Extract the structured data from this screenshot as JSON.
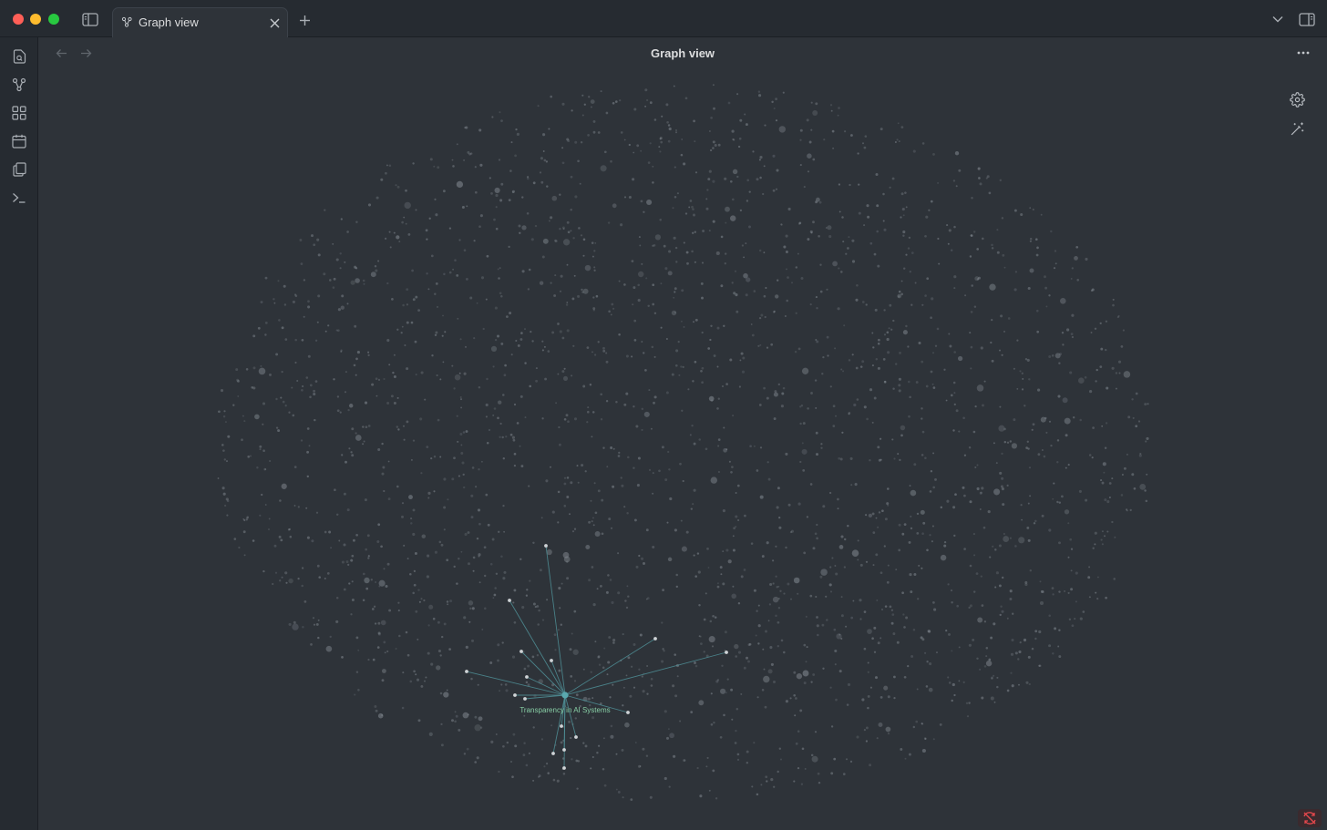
{
  "window": {
    "tab": {
      "label": "Graph view",
      "icon": "graph-icon"
    }
  },
  "toolbar": {
    "left_icons": [
      "sidebar-toggle-icon"
    ],
    "right_icons": [
      "chevron-down-icon",
      "right-sidebar-toggle-icon"
    ],
    "new_tab_icon": "plus-icon"
  },
  "ribbon": {
    "items": [
      {
        "name": "open-quick-switcher",
        "icon": "file-search-icon"
      },
      {
        "name": "open-graph-view",
        "icon": "graph-icon"
      },
      {
        "name": "open-canvas",
        "icon": "dashboard-icon"
      },
      {
        "name": "open-daily-note",
        "icon": "calendar-icon"
      },
      {
        "name": "insert-template",
        "icon": "files-icon"
      },
      {
        "name": "open-command-palette",
        "icon": "terminal-icon"
      }
    ]
  },
  "view_header": {
    "title": "Graph view",
    "back_icon": "arrow-left-icon",
    "forward_icon": "arrow-right-icon",
    "more_icon": "more-options-icon"
  },
  "graph": {
    "controls": [
      {
        "name": "graph-settings-button",
        "icon": "gear-icon"
      },
      {
        "name": "animate-button",
        "icon": "magic-wand-icon"
      }
    ],
    "highlighted_node": {
      "label": "Transparency in AI Systems"
    },
    "colors": {
      "background": "#2e3339",
      "node": "#8a9199",
      "highlight_node": "#5aa8ae",
      "highlight_edge": "#4f8f96",
      "label": "#88cfa6"
    }
  },
  "status": {
    "sync_icon": "sync-disabled-icon",
    "sync_color": "#e5484d"
  }
}
